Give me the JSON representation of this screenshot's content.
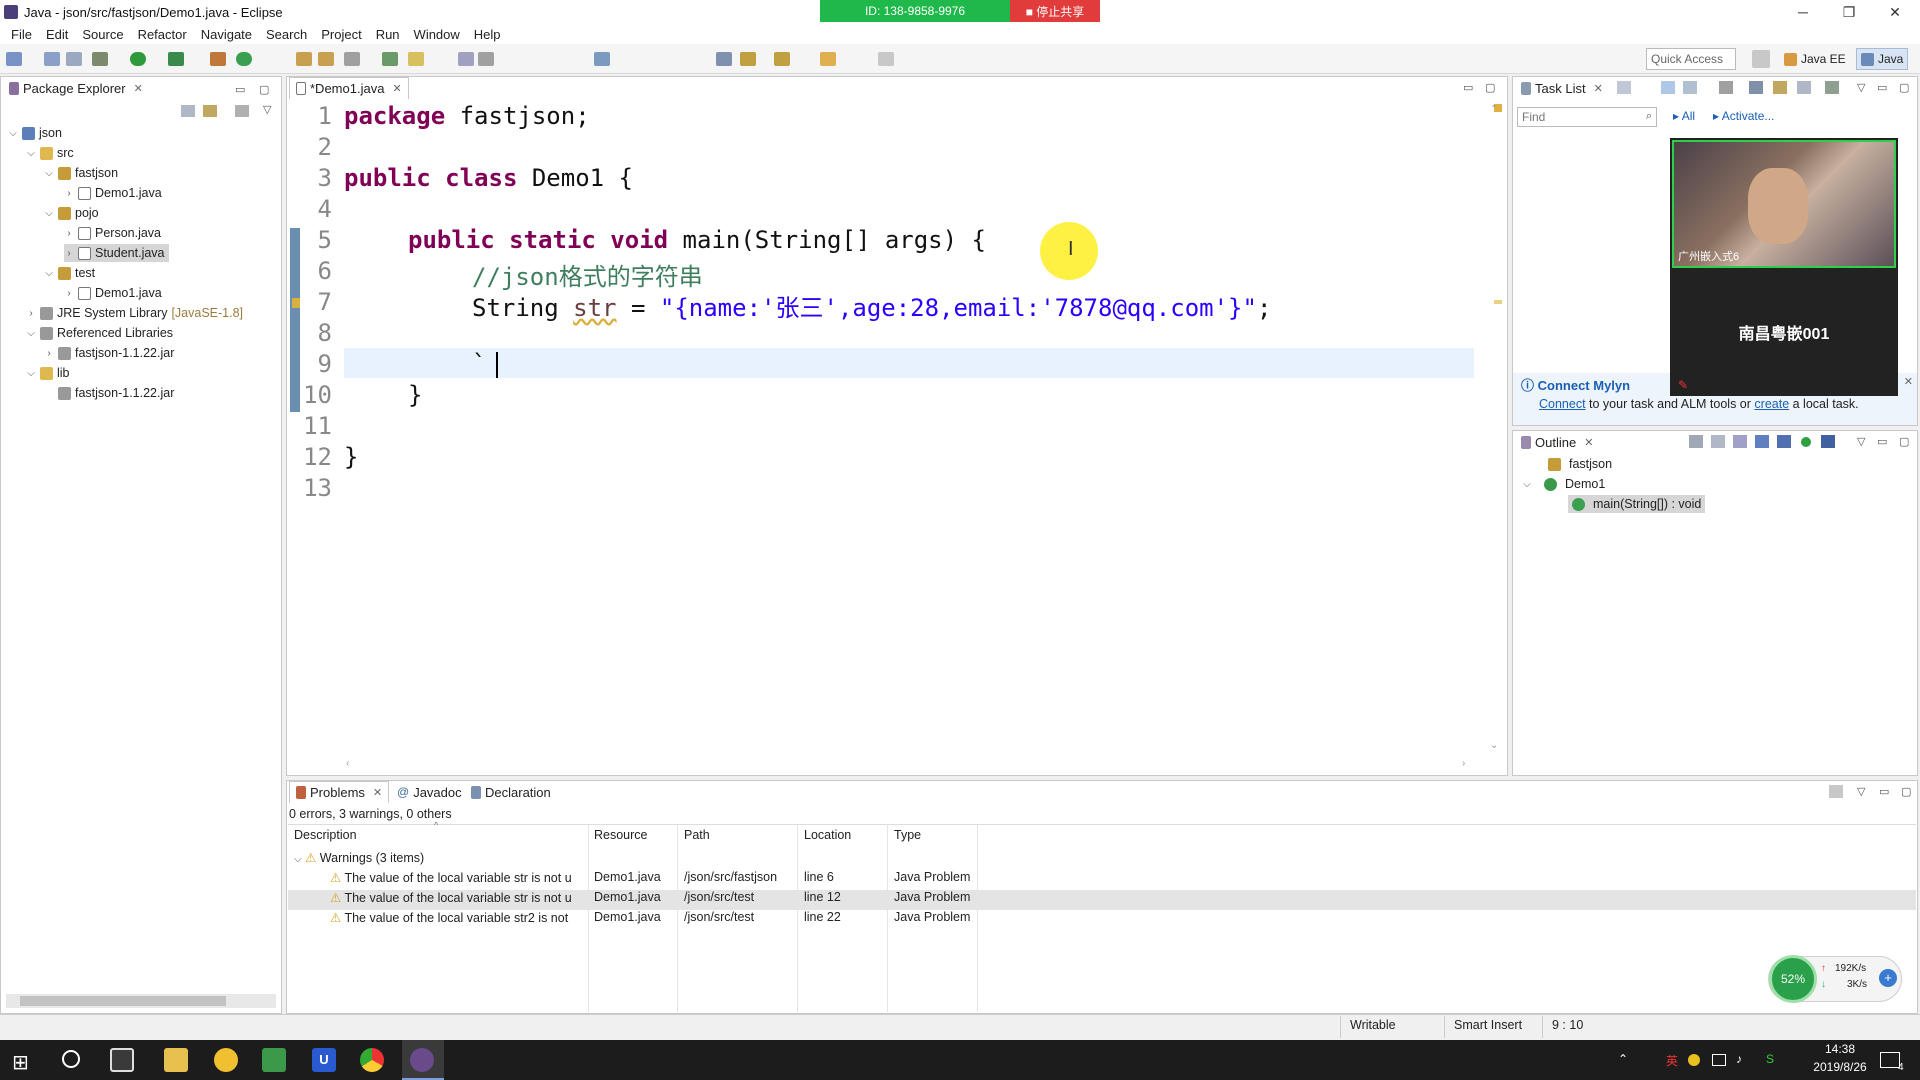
{
  "window": {
    "title": "Java - json/src/fastjson/Demo1.java - Eclipse",
    "minimize": "─",
    "restore": "❐",
    "close": "✕"
  },
  "share": {
    "id_label": "ID: 138-9858-9976",
    "stop_label": "■ 停止共享"
  },
  "menu": [
    "File",
    "Edit",
    "Source",
    "Refactor",
    "Navigate",
    "Search",
    "Project",
    "Run",
    "Window",
    "Help"
  ],
  "toolbar": {
    "quick_access": "Quick Access",
    "perspective_javaee": "Java EE",
    "perspective_java": "Java"
  },
  "package_explorer": {
    "tab": "Package Explorer",
    "tree": [
      {
        "label": "json",
        "type": "proj"
      },
      {
        "label": "src",
        "type": "folder"
      },
      {
        "label": "fastjson",
        "type": "pkg"
      },
      {
        "label": "Demo1.java",
        "type": "file"
      },
      {
        "label": "pojo",
        "type": "pkg"
      },
      {
        "label": "Person.java",
        "type": "file"
      },
      {
        "label": "Student.java",
        "type": "file"
      },
      {
        "label": "test",
        "type": "pkg"
      },
      {
        "label": "Demo1.java",
        "type": "file"
      },
      {
        "label": "JRE System Library",
        "type": "jar",
        "suffix": "[JavaSE-1.8]"
      },
      {
        "label": "Referenced Libraries",
        "type": "jar"
      },
      {
        "label": "fastjson-1.1.22.jar",
        "type": "jar"
      },
      {
        "label": "lib",
        "type": "folder"
      },
      {
        "label": "fastjson-1.1.22.jar",
        "type": "jar"
      }
    ]
  },
  "editor": {
    "tab": "*Demo1.java",
    "line_numbers": [
      "1",
      "2",
      "3",
      "4",
      "5",
      "6",
      "7",
      "8",
      "9",
      "10",
      "11",
      "12",
      "13"
    ],
    "line1": {
      "kw": "package",
      "rest": " fastjson;"
    },
    "line3": {
      "kw": "public class",
      "rest": " Demo1 {"
    },
    "line5": {
      "kw": "public static void",
      "rest": " main(String[] args) {"
    },
    "line6": "//json格式的字符串",
    "line7": {
      "type": "String ",
      "var": "str",
      "eq": " = ",
      "str": "\"{name:'张三',age:28,email:'7878@qq.com'}\"",
      "end": ";"
    },
    "line9": "`",
    "line10": "}",
    "line12": "}"
  },
  "tasklist": {
    "tab": "Task List",
    "find_placeholder": "Find",
    "all": "All",
    "activate": "Activate...",
    "mylyn_title": "Connect Mylyn",
    "mylyn_connect": "Connect",
    "mylyn_text1": " to your task and ALM tools or ",
    "mylyn_create": "create",
    "mylyn_text2": " a local task."
  },
  "video": {
    "caption": "广州嵌入式6",
    "name": "南昌粤嵌001"
  },
  "outline": {
    "tab": "Outline",
    "items": [
      "fastjson",
      "Demo1",
      "main(String[]) : void"
    ]
  },
  "bottom": {
    "tabs": [
      "Problems",
      "Javadoc",
      "Declaration"
    ],
    "summary": "0 errors, 3 warnings, 0 others",
    "columns": [
      "Description",
      "Resource",
      "Path",
      "Location",
      "Type"
    ],
    "group": "Warnings (3 items)",
    "rows": [
      {
        "desc": "The value of the local variable str is not u",
        "resource": "Demo1.java",
        "path": "/json/src/fastjson",
        "location": "line 6",
        "type": "Java Problem"
      },
      {
        "desc": "The value of the local variable str is not u",
        "resource": "Demo1.java",
        "path": "/json/src/test",
        "location": "line 12",
        "type": "Java Problem"
      },
      {
        "desc": "The value of the local variable str2 is not",
        "resource": "Demo1.java",
        "path": "/json/src/test",
        "location": "line 22",
        "type": "Java Problem"
      }
    ]
  },
  "status": {
    "writable": "Writable",
    "insert": "Smart Insert",
    "position": "9 : 10"
  },
  "netmon": {
    "percent": "52%",
    "up": "192K/s",
    "down": "3K/s"
  },
  "taskbar": {
    "time": "14:38",
    "date": "2019/8/26",
    "tray_char": "英",
    "notif_count": "4"
  }
}
